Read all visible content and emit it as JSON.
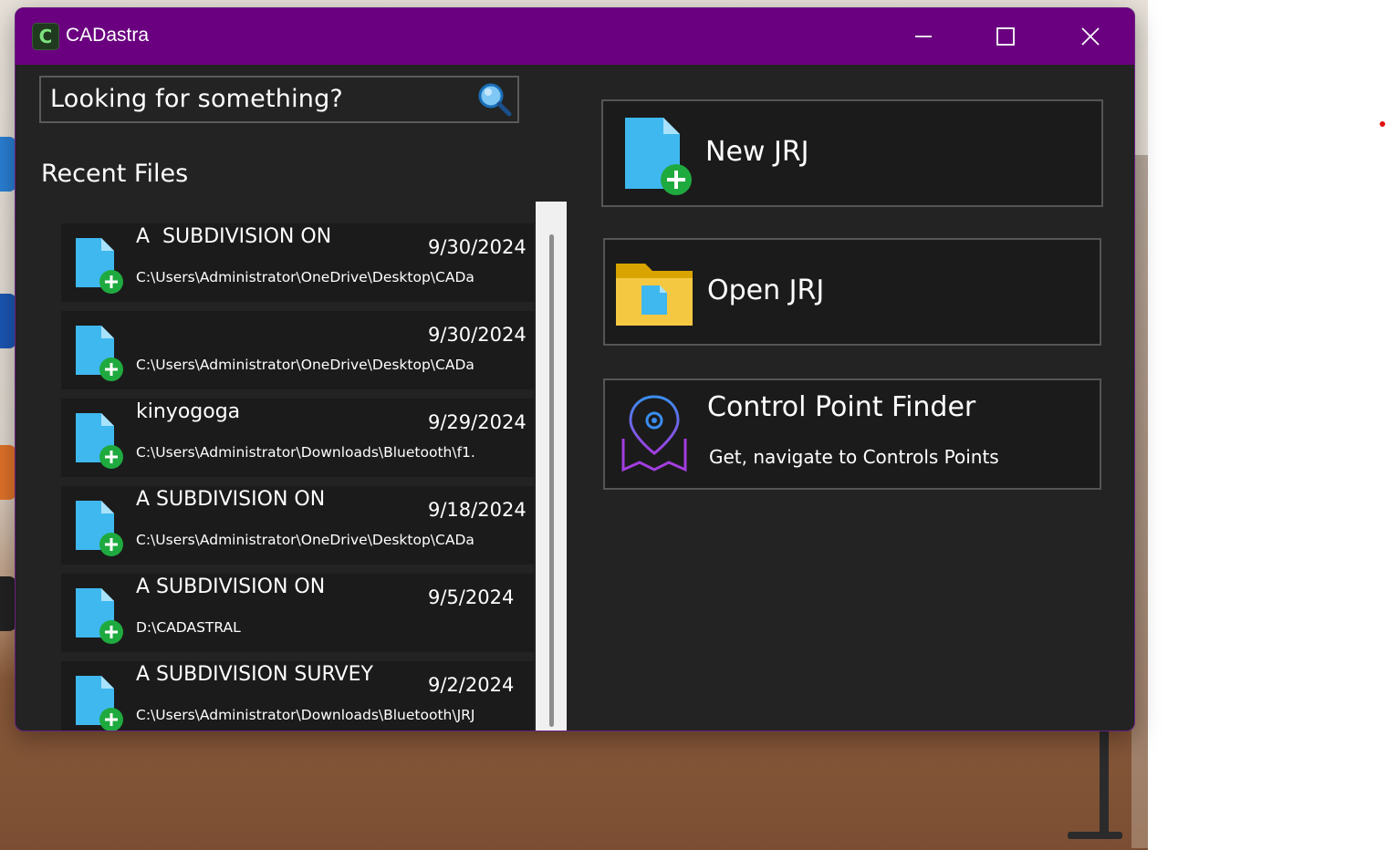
{
  "window": {
    "title": "CADastra",
    "app_icon_letter": "C",
    "accent_color": "#6a0080"
  },
  "search": {
    "placeholder": "Looking for something?",
    "icon": "magnifier-icon"
  },
  "recent": {
    "heading": "Recent Files",
    "items": [
      {
        "name": "A  SUBDIVISION ON",
        "date": "9/30/2024",
        "path": "C:\\Users\\Administrator\\OneDrive\\Desktop\\CADa",
        "icon": "new-file-icon"
      },
      {
        "name": "",
        "date": "9/30/2024",
        "path": "C:\\Users\\Administrator\\OneDrive\\Desktop\\CADa",
        "icon": "new-file-icon"
      },
      {
        "name": "kinyogoga",
        "date": "9/29/2024",
        "path": "C:\\Users\\Administrator\\Downloads\\Bluetooth\\f1.",
        "icon": "new-file-icon"
      },
      {
        "name": "A SUBDIVISION ON",
        "date": "9/18/2024",
        "path": "C:\\Users\\Administrator\\OneDrive\\Desktop\\CADa",
        "icon": "new-file-icon"
      },
      {
        "name": "A SUBDIVISION ON",
        "date": "9/5/2024",
        "path": "D:\\CADASTRAL",
        "icon": "new-file-icon"
      },
      {
        "name": "A SUBDIVISION SURVEY",
        "date": "9/2/2024",
        "path": "C:\\Users\\Administrator\\Downloads\\Bluetooth\\JRJ",
        "icon": "new-file-icon"
      }
    ]
  },
  "actions": {
    "new_jrj": {
      "label": "New JRJ",
      "icon": "new-file-icon"
    },
    "open_jrj": {
      "label": "Open JRJ",
      "icon": "folder-icon"
    },
    "control_point_finder": {
      "label": "Control Point Finder",
      "subtitle": "Get, navigate to Controls Points",
      "icon": "map-pin-icon"
    }
  }
}
